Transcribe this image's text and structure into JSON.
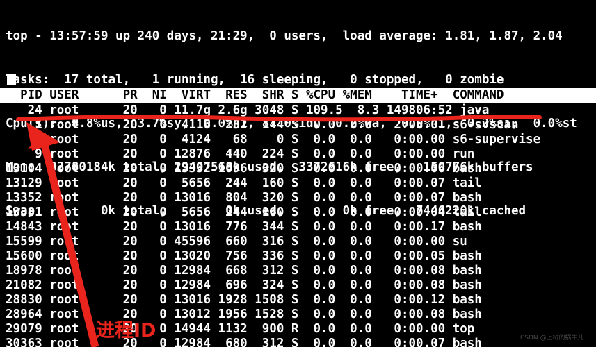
{
  "terminal": {
    "background_color": "#000000",
    "foreground_color": "#ffffff",
    "header_background_color": "#ffffff",
    "header_foreground_color": "#000000",
    "annotation_color": "#e8241c"
  },
  "summary": {
    "line_uptime": "top - 13:57:59 up 240 days, 21:29,  0 users,  load average: 1.81, 1.87, 2.04",
    "line_tasks": "Tasks:  17 total,   1 running,  16 sleeping,   0 stopped,   0 zombie",
    "line_cpu": "Cpu(s):  8.8%us,  3.7%sy,  0.0%ni, 87.0%id,  0.2%wa,  0.0%hi,  0.2%si,  0.0%st",
    "line_mem": "Mem:  32780184k total, 29407568k used,  3372616k free,   150776k buffers",
    "line_swap": "Swap:        0k total,        0k used,        0k free,  7446220k cached",
    "fields": {
      "time": "13:57:59",
      "up_days": "240",
      "up_time": "21:29",
      "users": "0",
      "load_1min": "1.81",
      "load_5min": "1.87",
      "load_15min": "2.04",
      "tasks_total": "17",
      "tasks_running": "1",
      "tasks_sleeping": "16",
      "tasks_stopped": "0",
      "tasks_zombie": "0",
      "cpu_us": "8.8",
      "cpu_sy": "3.7",
      "cpu_ni": "0.0",
      "cpu_id": "87.0",
      "cpu_wa": "0.2",
      "cpu_hi": "0.0",
      "cpu_si": "0.2",
      "cpu_st": "0.0",
      "mem_total": "32780184k",
      "mem_used": "29407568k",
      "mem_free": "3372616k",
      "mem_buffers": "150776k",
      "swap_total": "0k",
      "swap_used": "0k",
      "swap_free": "0k",
      "swap_cached": "7446220k"
    }
  },
  "table": {
    "header_line": "  PID USER      PR  NI  VIRT  RES  SHR S %CPU %MEM    TIME+  COMMAND",
    "columns": [
      "PID",
      "USER",
      "PR",
      "NI",
      "VIRT",
      "RES",
      "SHR",
      "S",
      "%CPU",
      "%MEM",
      "TIME+",
      "COMMAND"
    ],
    "rows": [
      "   24 root      20   0 11.7g 2.6g 3048 S 109.5  8.3 149806:52 java",
      "    1 root      20   0  4116  232  144 S  0.0  0.0   2:08.01 s6-svscan",
      "    6 root      20   0  4124   68    0 S  0.0  0.0   0:00.00 s6-supervise",
      "    9 root      20   0 12876  440  224 S  0.0  0.0   0:00.00 run",
      "13104 root      20   0 13332 1096  320 S  0.0  0.0   0:00.06 bash",
      "13129 root      20   0  5656  244  160 S  0.0  0.0   0:00.07 tail",
      "13352 root      20   0 13016  804  320 S  0.0  0.0   0:00.07 bash",
      "13381 root      20   0  5656  244  160 S  0.0  0.0   0:00.04 tail",
      "14843 root      20   0 13016  776  344 S  0.0  0.0   0:00.17 bash",
      "15599 root      20   0 45596  660  316 S  0.0  0.0   0:00.00 su",
      "15600 root      20   0 13020  756  336 S  0.0  0.0   0:00.05 bash",
      "18978 root      20   0 12984  668  312 S  0.0  0.0   0:00.08 bash",
      "21082 root      20   0 12984  696  324 S  0.0  0.0   0:00.08 bash",
      "28830 root      20   0 13016 1928 1508 S  0.0  0.0   0:00.12 bash",
      "28964 root      20   0 13012 1956 1528 S  0.0  0.0   0:00.08 bash",
      "29079 root      20   0 14944 1132  900 R  0.0  0.0   0:00.00 top",
      "30363 root      20   0 12984  680  312 S  0.0  0.0   0:00.07 bash"
    ],
    "rows_structured": [
      {
        "pid": "24",
        "user": "root",
        "pr": "20",
        "ni": "0",
        "virt": "11.7g",
        "res": "2.6g",
        "shr": "3048",
        "s": "S",
        "cpu": "109.5",
        "mem": "8.3",
        "time": "149806:52",
        "command": "java"
      },
      {
        "pid": "1",
        "user": "root",
        "pr": "20",
        "ni": "0",
        "virt": "4116",
        "res": "232",
        "shr": "144",
        "s": "S",
        "cpu": "0.0",
        "mem": "0.0",
        "time": "2:08.01",
        "command": "s6-svscan"
      },
      {
        "pid": "6",
        "user": "root",
        "pr": "20",
        "ni": "0",
        "virt": "4124",
        "res": "68",
        "shr": "0",
        "s": "S",
        "cpu": "0.0",
        "mem": "0.0",
        "time": "0:00.00",
        "command": "s6-supervise"
      },
      {
        "pid": "9",
        "user": "root",
        "pr": "20",
        "ni": "0",
        "virt": "12876",
        "res": "440",
        "shr": "224",
        "s": "S",
        "cpu": "0.0",
        "mem": "0.0",
        "time": "0:00.00",
        "command": "run"
      },
      {
        "pid": "13104",
        "user": "root",
        "pr": "20",
        "ni": "0",
        "virt": "13332",
        "res": "1096",
        "shr": "320",
        "s": "S",
        "cpu": "0.0",
        "mem": "0.0",
        "time": "0:00.06",
        "command": "bash"
      },
      {
        "pid": "13129",
        "user": "root",
        "pr": "20",
        "ni": "0",
        "virt": "5656",
        "res": "244",
        "shr": "160",
        "s": "S",
        "cpu": "0.0",
        "mem": "0.0",
        "time": "0:00.07",
        "command": "tail"
      },
      {
        "pid": "13352",
        "user": "root",
        "pr": "20",
        "ni": "0",
        "virt": "13016",
        "res": "804",
        "shr": "320",
        "s": "S",
        "cpu": "0.0",
        "mem": "0.0",
        "time": "0:00.07",
        "command": "bash"
      },
      {
        "pid": "13381",
        "user": "root",
        "pr": "20",
        "ni": "0",
        "virt": "5656",
        "res": "244",
        "shr": "160",
        "s": "S",
        "cpu": "0.0",
        "mem": "0.0",
        "time": "0:00.04",
        "command": "tail"
      },
      {
        "pid": "14843",
        "user": "root",
        "pr": "20",
        "ni": "0",
        "virt": "13016",
        "res": "776",
        "shr": "344",
        "s": "S",
        "cpu": "0.0",
        "mem": "0.0",
        "time": "0:00.17",
        "command": "bash"
      },
      {
        "pid": "15599",
        "user": "root",
        "pr": "20",
        "ni": "0",
        "virt": "45596",
        "res": "660",
        "shr": "316",
        "s": "S",
        "cpu": "0.0",
        "mem": "0.0",
        "time": "0:00.00",
        "command": "su"
      },
      {
        "pid": "15600",
        "user": "root",
        "pr": "20",
        "ni": "0",
        "virt": "13020",
        "res": "756",
        "shr": "336",
        "s": "S",
        "cpu": "0.0",
        "mem": "0.0",
        "time": "0:00.05",
        "command": "bash"
      },
      {
        "pid": "18978",
        "user": "root",
        "pr": "20",
        "ni": "0",
        "virt": "12984",
        "res": "668",
        "shr": "312",
        "s": "S",
        "cpu": "0.0",
        "mem": "0.0",
        "time": "0:00.08",
        "command": "bash"
      },
      {
        "pid": "21082",
        "user": "root",
        "pr": "20",
        "ni": "0",
        "virt": "12984",
        "res": "696",
        "shr": "324",
        "s": "S",
        "cpu": "0.0",
        "mem": "0.0",
        "time": "0:00.08",
        "command": "bash"
      },
      {
        "pid": "28830",
        "user": "root",
        "pr": "20",
        "ni": "0",
        "virt": "13016",
        "res": "1928",
        "shr": "1508",
        "s": "S",
        "cpu": "0.0",
        "mem": "0.0",
        "time": "0:00.12",
        "command": "bash"
      },
      {
        "pid": "28964",
        "user": "root",
        "pr": "20",
        "ni": "0",
        "virt": "13012",
        "res": "1956",
        "shr": "1528",
        "s": "S",
        "cpu": "0.0",
        "mem": "0.0",
        "time": "0:00.08",
        "command": "bash"
      },
      {
        "pid": "29079",
        "user": "root",
        "pr": "20",
        "ni": "0",
        "virt": "14944",
        "res": "1132",
        "shr": "900",
        "s": "R",
        "cpu": "0.0",
        "mem": "0.0",
        "time": "0:00.00",
        "command": "top"
      },
      {
        "pid": "30363",
        "user": "root",
        "pr": "20",
        "ni": "0",
        "virt": "12984",
        "res": "680",
        "shr": "312",
        "s": "S",
        "cpu": "0.0",
        "mem": "0.0",
        "time": "0:00.07",
        "command": "bash"
      }
    ]
  },
  "annotations": {
    "label": "进程ID",
    "underline_color": "#e8241c",
    "arrow_color": "#e8241c"
  },
  "watermark": {
    "text": "CSDN @上树的蜗牛儿"
  }
}
